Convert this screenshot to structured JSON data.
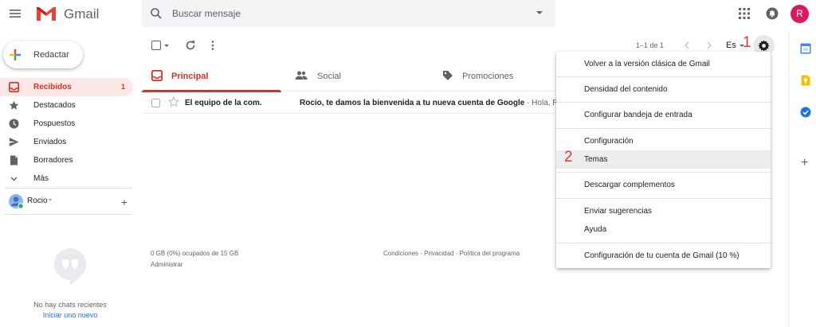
{
  "header": {
    "app_name": "Gmail",
    "search_placeholder": "Buscar mensaje",
    "avatar_letter": "R"
  },
  "compose": {
    "label": "Redactar"
  },
  "nav": [
    {
      "label": "Recibidos",
      "count": "1",
      "icon": "inbox-icon",
      "active": true
    },
    {
      "label": "Destacados",
      "icon": "star-icon"
    },
    {
      "label": "Pospuestos",
      "icon": "clock-icon"
    },
    {
      "label": "Enviados",
      "icon": "send-icon"
    },
    {
      "label": "Borradores",
      "icon": "draft-icon"
    },
    {
      "label": "Más",
      "icon": "chevron-down-icon"
    }
  ],
  "user": {
    "name": "Rocio"
  },
  "chats": {
    "empty": "No hay chats recientes",
    "start": "Iniciar uno nuevo"
  },
  "toolbar": {
    "page_info": "1–1 de 1",
    "language": "Es"
  },
  "markers": {
    "one": "1",
    "two": "2"
  },
  "tabs": [
    {
      "label": "Principal",
      "icon": "inbox-icon",
      "active": true
    },
    {
      "label": "Social",
      "icon": "people-icon"
    },
    {
      "label": "Promociones",
      "icon": "tag-icon"
    }
  ],
  "emails": [
    {
      "sender": "El equipo de la com.",
      "subject": "Rocio, te damos la bienvenida a tu nueva cuenta de Google",
      "snippet": " · Hola, Ro"
    }
  ],
  "footer": {
    "storage": "0 GB (0%) ocupados de 15 GB",
    "manage": "Administrar",
    "terms": "Condiciones · Privacidad · Política del programa"
  },
  "settings_menu": [
    "Volver a la versión clásica de Gmail",
    "Densidad del contenido",
    "Configurar bandeja de entrada",
    "Configuración",
    "Temas",
    "Descargar complementos",
    "Enviar sugerencias",
    "Ayuda",
    "Configuración de tu cuenta de Gmail (10 %)"
  ],
  "colors": {
    "accent_red": "#d93025",
    "marker_red": "#e53935",
    "active_bg": "#fce8e6",
    "menu_highlight": "#ededed",
    "link_blue": "#1a73e8"
  }
}
